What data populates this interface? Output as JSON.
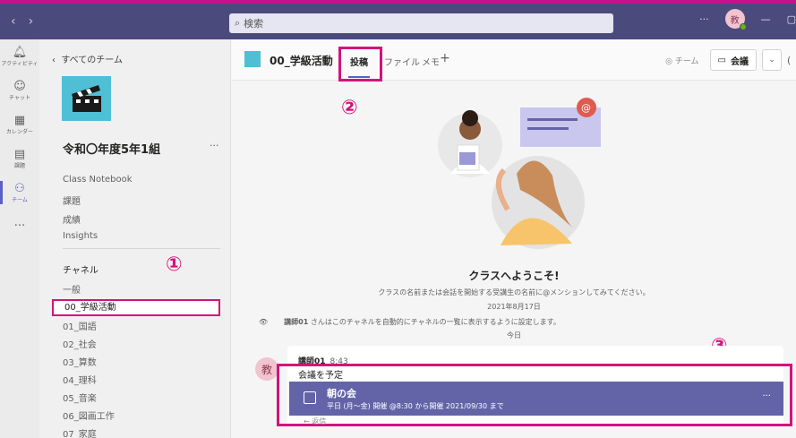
{
  "titlebar": {
    "search_placeholder": "検索",
    "more": "···",
    "avatar_initial": "教",
    "minimize": "—",
    "restore": "▢"
  },
  "rail": {
    "items": [
      {
        "label": "アクティビティ",
        "icon": "bell-icon"
      },
      {
        "label": "チャット",
        "icon": "chat-icon"
      },
      {
        "label": "カレンダー",
        "icon": "calendar-icon"
      },
      {
        "label": "課題",
        "icon": "assignments-icon"
      },
      {
        "label": "チーム",
        "icon": "teams-icon"
      },
      {
        "label": "···",
        "icon": "more-icon"
      }
    ]
  },
  "sidebar": {
    "back_label": "すべてのチーム",
    "team_name": "令和〇年度5年1組",
    "team_more": "···",
    "menu": [
      "Class Notebook",
      "課題",
      "成績",
      "Insights"
    ],
    "channels_header": "チャネル",
    "channels": [
      "一般",
      "00_学級活動",
      "01_国語",
      "02_社会",
      "03_算数",
      "04_理科",
      "05_音楽",
      "06_図画工作",
      "07_家庭"
    ]
  },
  "header": {
    "channel_title": "00_学級活動",
    "tabs": [
      "投稿",
      "ファイル",
      "メモ"
    ],
    "add_tab": "+",
    "team_label": "チーム",
    "meet_label": "会議"
  },
  "annotations": {
    "one": "①",
    "two": "②",
    "three": "③"
  },
  "welcome": {
    "title": "クラスへようこそ!",
    "subtitle": "クラスの名前または会話を開始する受講生の名前に@メンションしてみてください。",
    "date": "2021年8月17日",
    "system_author": "講師01",
    "system_message": "さんはこのチャネルを自動的にチャネルの一覧に表示するように設定します。",
    "today": "今日"
  },
  "post": {
    "avatar": "教",
    "author": "講師01",
    "time": "8:43",
    "text": "会議を予定",
    "meeting_title": "朝の会",
    "meeting_detail": "平日 (月〜金) 開催 @8:30 から開催 2021/09/30 まで",
    "meeting_more": "···",
    "reply": "← 返信"
  },
  "colors": {
    "accent": "#6264a7",
    "highlight": "#d3137a",
    "titlebar": "#4b4a7d"
  }
}
